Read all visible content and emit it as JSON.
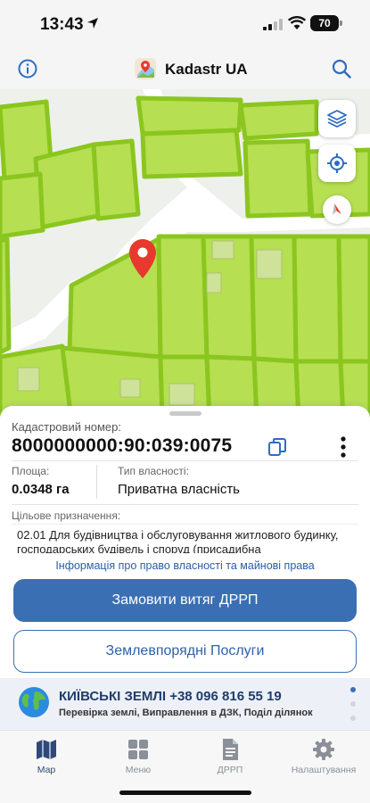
{
  "status_bar": {
    "time": "13:43",
    "battery": "70"
  },
  "header": {
    "title": "Kadastr UA"
  },
  "colors": {
    "parcel_fill": "#b6df52",
    "parcel_stroke": "#8bc61f",
    "road": "#ffffff",
    "accent": "#3b6fb3",
    "pin": "#e8392e"
  },
  "parcel": {
    "cadastral_label": "Кадастровий номер:",
    "cadastral_number": "8000000000:90:039:0075",
    "area_label": "Площа:",
    "area_value": "0.0348 га",
    "ownership_label": "Тип власності:",
    "ownership_value": "Приватна власність",
    "purpose_label": "Цільове призначення:",
    "purpose_text": "02.01 Для будівництва і обслуговування житлового будинку, господарських будівель і споруд (присадибна"
  },
  "links": {
    "rights_info": "Інформація про право власності та майнові права"
  },
  "buttons": {
    "order_extract": "Замовити витяг ДРРП",
    "land_services": "Землевпорядні Послуги"
  },
  "banner": {
    "title": "КИЇВСЬКІ ЗЕМЛІ +38 096 816 55 19",
    "subtitle": "Перевірка землі, Виправлення в ДЗК, Поділ ділянок"
  },
  "tabs": [
    {
      "label": "Мар",
      "icon": "map-icon",
      "active": true
    },
    {
      "label": "Меню",
      "icon": "grid-icon",
      "active": false
    },
    {
      "label": "ДРРП",
      "icon": "document-icon",
      "active": false
    },
    {
      "label": "Налаштування",
      "icon": "gear-icon",
      "active": false
    }
  ]
}
